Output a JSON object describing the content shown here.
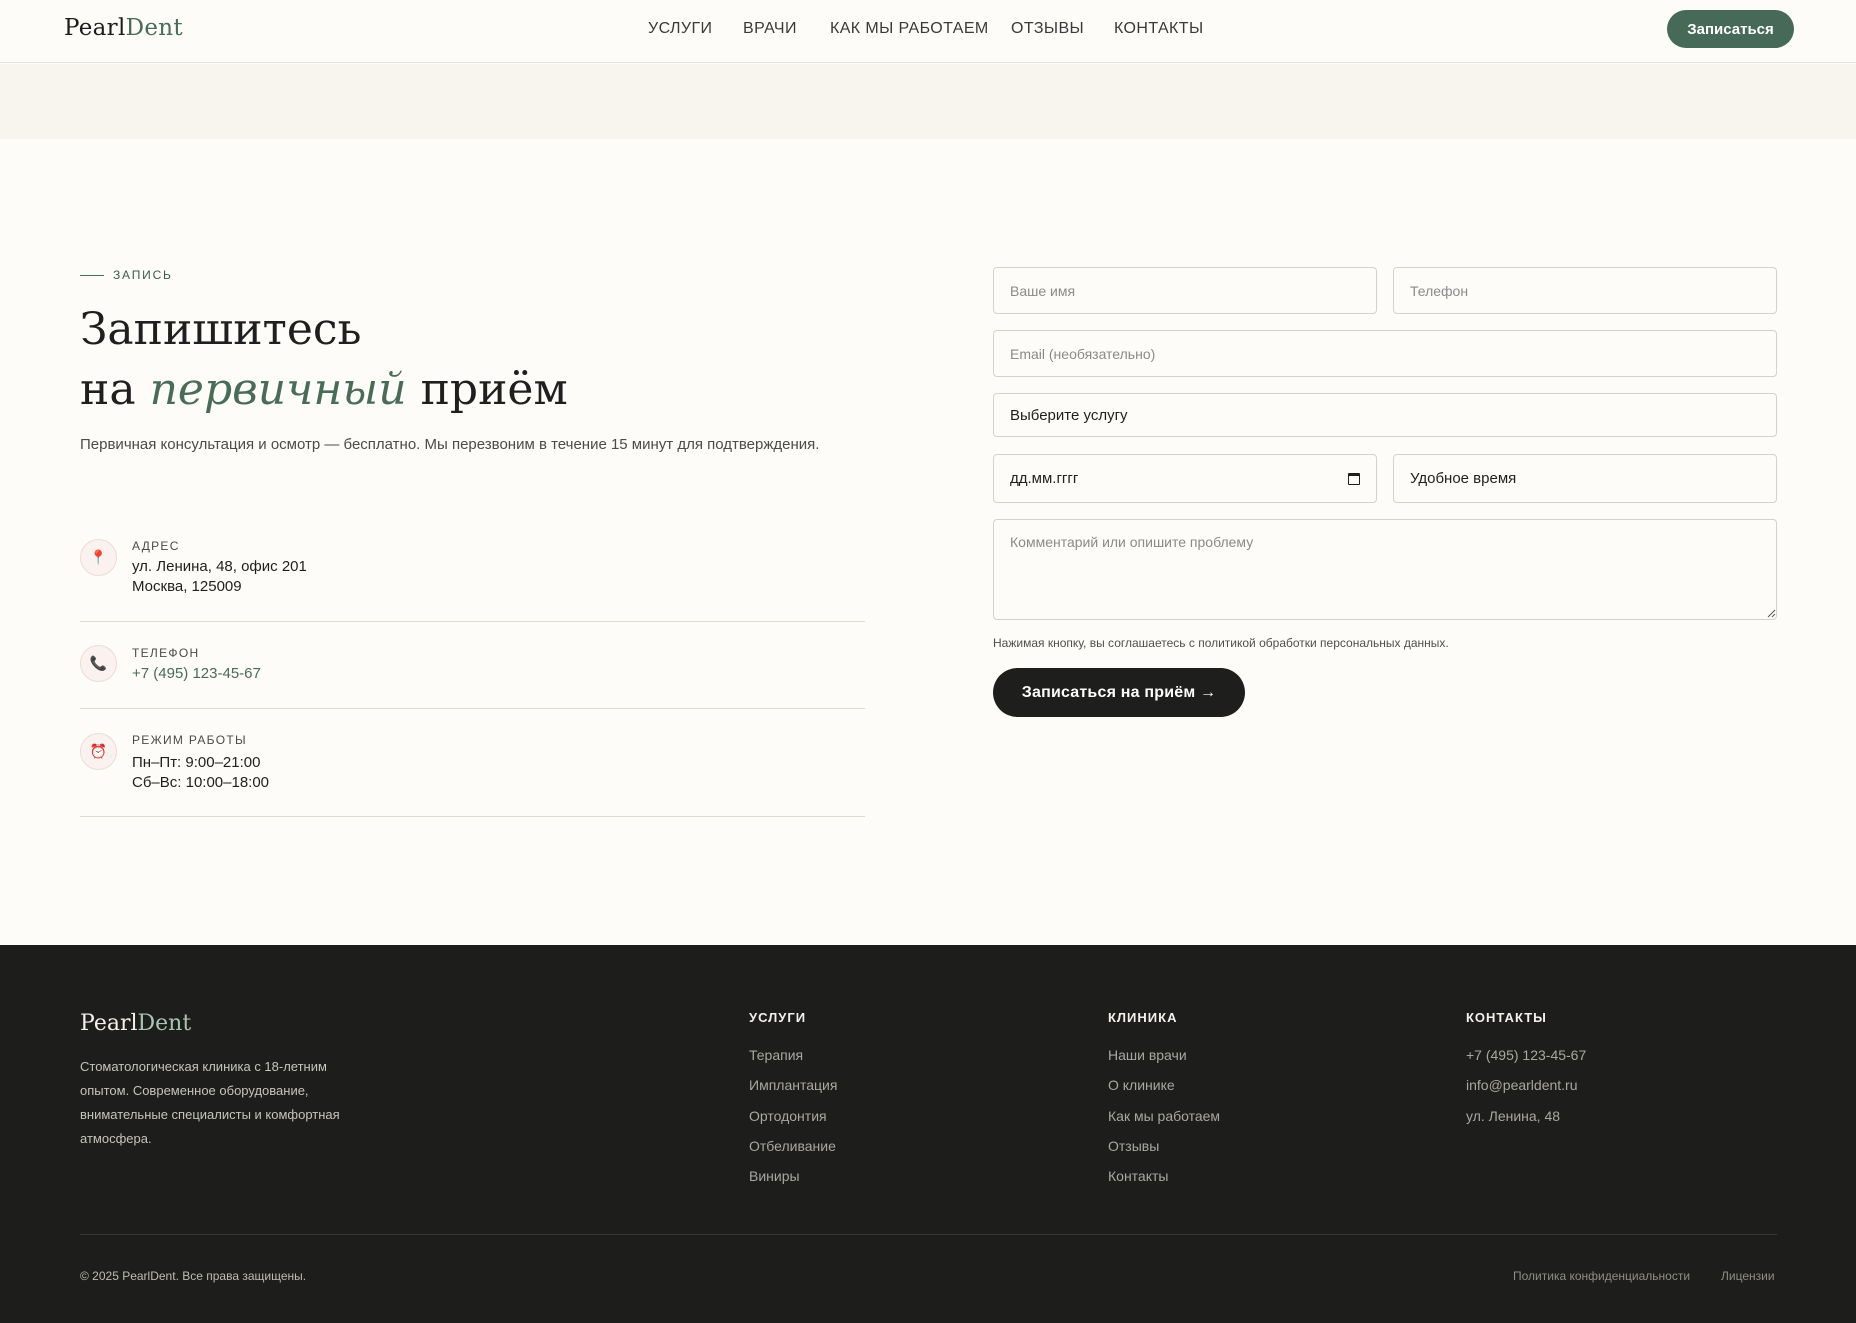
{
  "header": {
    "logo_part1": "Pearl",
    "logo_part2": "Dent",
    "nav": [
      "УСЛУГИ",
      "ВРАЧИ",
      "КАК МЫ РАБОТАЕМ",
      "ОТЗЫВЫ",
      "КОНТАКТЫ"
    ],
    "cta_label": "Записаться"
  },
  "booking": {
    "eyebrow": "ЗАПИСЬ",
    "title_line1": "Запишитесь",
    "title_line2_start": "на",
    "title_line2_em": "первичный",
    "title_line2_end": "приём",
    "subtitle": "Первичная консультация и осмотр — бесплатно. Мы перезвоним в течение 15 минут для подтверждения."
  },
  "info": {
    "address": {
      "label": "АДРЕС",
      "line1": "ул. Ленина, 48, офис 201",
      "line2": "Москва, 125009",
      "icon": "map-pin-icon"
    },
    "phone": {
      "label": "ТЕЛЕФОН",
      "value": "+7 (495) 123-45-67",
      "icon": "phone-icon"
    },
    "hours": {
      "label": "РЕЖИМ РАБОТЫ",
      "line1": "Пн–Пт: 9:00–21:00",
      "line2": "Сб–Вс: 10:00–18:00",
      "icon": "alarm-clock-icon"
    }
  },
  "form": {
    "name_placeholder": "Ваше имя",
    "phone_placeholder": "Телефон",
    "email_placeholder": "Email (необязательно)",
    "service_value": "Выберите услугу",
    "date_value": "дд.мм.гггг",
    "time_value": "Удобное время",
    "comment_placeholder": "Комментарий или опишите проблему",
    "consent": "Нажимая кнопку, вы соглашаетесь с политикой обработки персональных данных.",
    "submit_label": "Записаться на приём →"
  },
  "footer": {
    "logo_part1": "Pearl",
    "logo_part2": "Dent",
    "description": "Стоматологическая клиника с 18-летним опытом. Современное оборудование, внимательные специалисты и комфортная атмосфера.",
    "columns": [
      {
        "heading": "УСЛУГИ",
        "links": [
          "Терапия",
          "Имплантация",
          "Ортодонтия",
          "Отбеливание",
          "Виниры"
        ]
      },
      {
        "heading": "КЛИНИКА",
        "links": [
          "Наши врачи",
          "О клинике",
          "Как мы работаем",
          "Отзывы",
          "Контакты"
        ]
      },
      {
        "heading": "КОНТАКТЫ",
        "links": [
          "+7 (495) 123-45-67",
          "info@pearldent.ru",
          "ул. Ленина, 48"
        ]
      }
    ],
    "copyright": "© 2025 PearlDent. Все права защищены.",
    "legal": [
      "Политика конфиденциальности",
      "Лицензии"
    ]
  },
  "colors": {
    "accent": "#466a57",
    "background": "#fdfcf8",
    "band": "#f7f5ee",
    "footer": "#1d1d1b",
    "icon_accent": "#c8325b"
  }
}
